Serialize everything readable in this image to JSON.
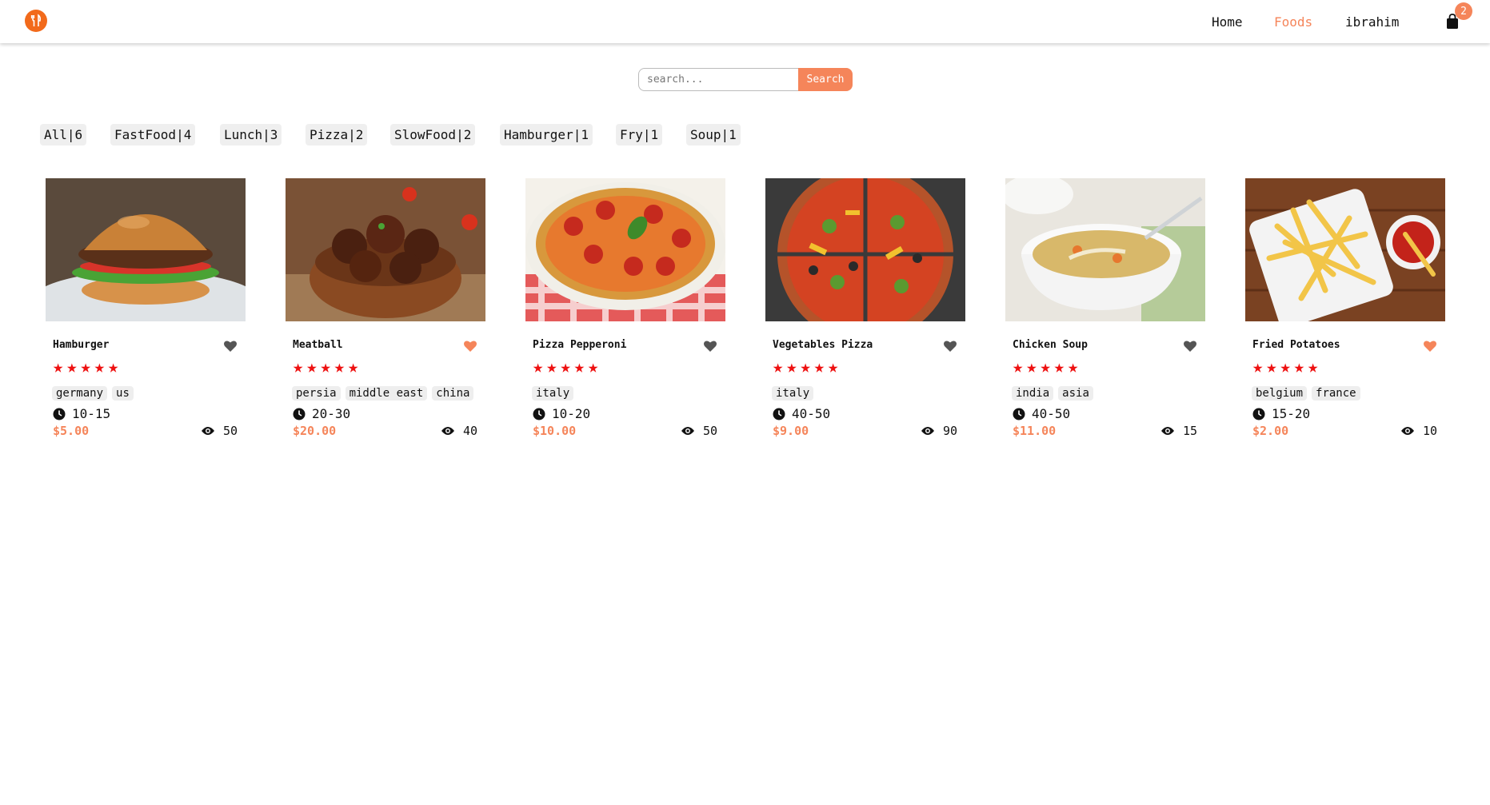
{
  "header": {
    "logo_icon": "fork-knife-icon",
    "nav": {
      "home": "Home",
      "foods": "Foods",
      "user": "ibrahim"
    },
    "cart_icon": "shopping-bag-icon",
    "cart_count": "2",
    "active_color": "#f5855a"
  },
  "search": {
    "placeholder": "search...",
    "button": "Search"
  },
  "tags": [
    "All|6",
    "FastFood|4",
    "Lunch|3",
    "Pizza|2",
    "SlowFood|2",
    "Hamburger|1",
    "Fry|1",
    "Soup|1"
  ],
  "foods": [
    {
      "name": "Hamburger",
      "favorite": false,
      "stars": 5,
      "origins": [
        "germany",
        "us"
      ],
      "time": "10-15",
      "price": "$5.00",
      "views": "50"
    },
    {
      "name": "Meatball",
      "favorite": true,
      "stars": 5,
      "origins": [
        "persia",
        "middle east",
        "china"
      ],
      "time": "20-30",
      "price": "$20.00",
      "views": "40"
    },
    {
      "name": "Pizza Pepperoni",
      "favorite": false,
      "stars": 5,
      "origins": [
        "italy"
      ],
      "time": "10-20",
      "price": "$10.00",
      "views": "50"
    },
    {
      "name": "Vegetables Pizza",
      "favorite": false,
      "stars": 5,
      "origins": [
        "italy"
      ],
      "time": "40-50",
      "price": "$9.00",
      "views": "90"
    },
    {
      "name": "Chicken Soup",
      "favorite": false,
      "stars": 5,
      "origins": [
        "india",
        "asia"
      ],
      "time": "40-50",
      "price": "$11.00",
      "views": "15"
    },
    {
      "name": "Fried Potatoes",
      "favorite": true,
      "stars": 5,
      "origins": [
        "belgium",
        "france"
      ],
      "time": "15-20",
      "price": "$2.00",
      "views": "10"
    }
  ],
  "colors": {
    "accent": "#f5855a",
    "star": "#ee1111",
    "heart_off": "#555555",
    "heart_on": "#f5855a"
  }
}
